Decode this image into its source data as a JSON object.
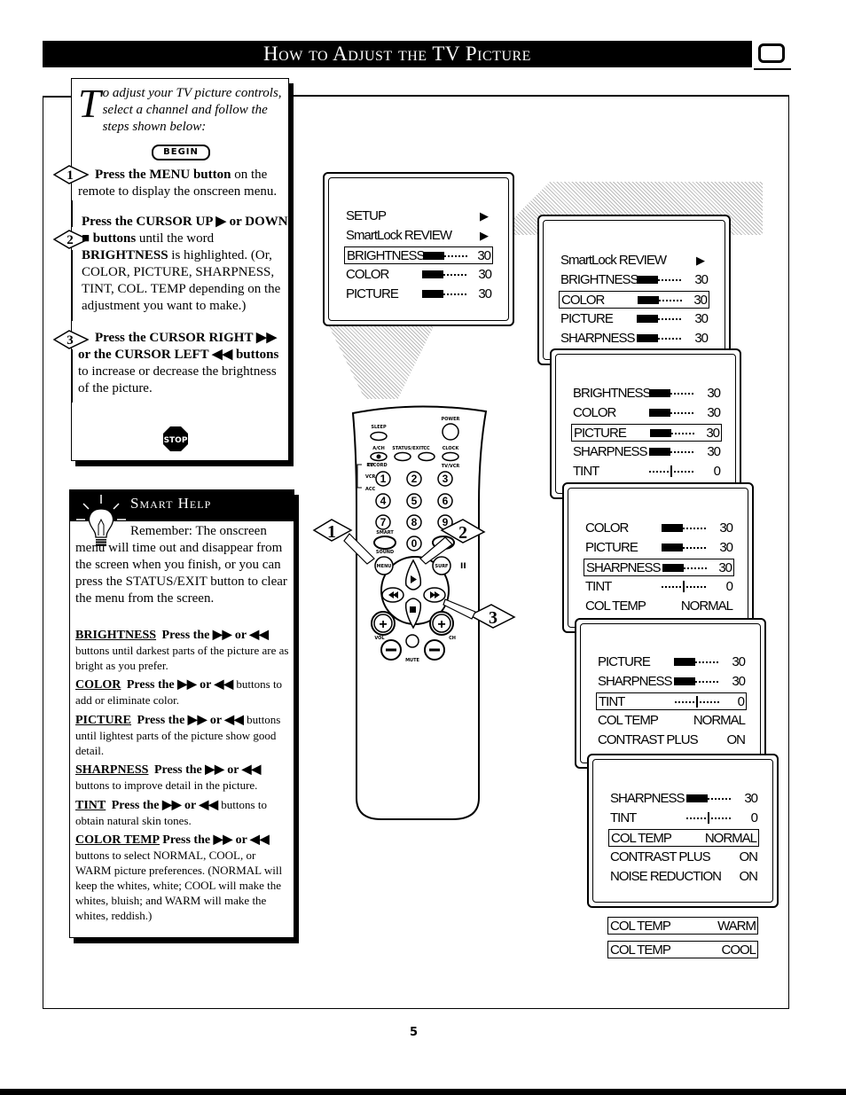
{
  "header": {
    "title": "How to Adjust the TV Picture",
    "icon": "tv-screen-icon"
  },
  "intro": {
    "drop_cap": "T",
    "text": "o adjust your TV picture controls, select a channel and follow the steps shown below:",
    "begin_label": "BEGIN"
  },
  "steps": [
    {
      "number": "1",
      "bold": "Press the MENU button",
      "text": " on the remote to display the onscreen menu."
    },
    {
      "number": "2",
      "bold": "Press the CURSOR UP ▶ or DOWN ■ buttons",
      "text": " until the word ",
      "bold2": "BRIGHTNESS",
      "text2": " is highlighted. (Or, COLOR, PICTURE, SHARPNESS, TINT, COL. TEMP depending on the adjustment you want to make.)"
    },
    {
      "number": "3",
      "bold": "Press the CURSOR RIGHT ▶▶ or the CURSOR LEFT ◀◀ buttons",
      "text": " to increase or decrease the brightness of the picture."
    }
  ],
  "stop_label": "STOP",
  "smart_help": {
    "title": "Smart Help",
    "intro": "Remember: The onscreen menu will time out and disappear from the screen when you finish, or you can press the STATUS/EXIT button to clear the menu from the screen.",
    "items": [
      {
        "keyword": "BRIGHTNESS",
        "lead": "Press the ▶▶ or ◀◀",
        "text": " buttons until darkest parts of the picture are as bright as you prefer."
      },
      {
        "keyword": "COLOR",
        "lead": "Press the ▶▶ or ◀◀",
        "text": " buttons to add or eliminate color."
      },
      {
        "keyword": "PICTURE",
        "lead": "Press the ▶▶ or ◀◀",
        "text": " buttons until lightest parts of the picture show good detail."
      },
      {
        "keyword": "SHARPNESS",
        "lead": "Press the ▶▶ or ◀◀",
        "text": " buttons to improve detail in the picture."
      },
      {
        "keyword": "TINT",
        "lead": "Press the ▶▶ or ◀◀",
        "text": " buttons to obtain natural skin tones."
      },
      {
        "keyword": "COLOR TEMP",
        "lead": "Press the ▶▶ or ◀◀",
        "text": " buttons to select NORMAL, COOL, or WARM picture preferences. (NORMAL will keep the whites, white; COOL will make the whites, bluish; and WARM will make the whites, reddish.)"
      }
    ]
  },
  "screens": [
    {
      "rows": [
        {
          "label": "SETUP",
          "type": "arrow"
        },
        {
          "label": "SmartLock REVIEW",
          "type": "arrow"
        },
        {
          "label": "BRIGHTNESS",
          "type": "bar",
          "value": "30",
          "level": 0.5,
          "highlight": true
        },
        {
          "label": "COLOR",
          "type": "bar",
          "value": "30",
          "level": 0.5
        },
        {
          "label": "PICTURE",
          "type": "bar",
          "value": "30",
          "level": 0.5
        }
      ]
    },
    {
      "rows": [
        {
          "label": "SmartLock REVIEW",
          "type": "arrow"
        },
        {
          "label": "BRIGHTNESS",
          "type": "bar",
          "value": "30",
          "level": 0.5
        },
        {
          "label": "COLOR",
          "type": "bar",
          "value": "30",
          "level": 0.5,
          "highlight": true
        },
        {
          "label": "PICTURE",
          "type": "bar",
          "value": "30",
          "level": 0.5
        },
        {
          "label": "SHARPNESS",
          "type": "bar",
          "value": "30",
          "level": 0.5
        }
      ]
    },
    {
      "rows": [
        {
          "label": "BRIGHTNESS",
          "type": "bar",
          "value": "30",
          "level": 0.5
        },
        {
          "label": "COLOR",
          "type": "bar",
          "value": "30",
          "level": 0.5
        },
        {
          "label": "PICTURE",
          "type": "bar",
          "value": "30",
          "level": 0.5,
          "highlight": true
        },
        {
          "label": "SHARPNESS",
          "type": "bar",
          "value": "30",
          "level": 0.5
        },
        {
          "label": "TINT",
          "type": "tint",
          "value": "0"
        }
      ]
    },
    {
      "rows": [
        {
          "label": "COLOR",
          "type": "bar",
          "value": "30",
          "level": 0.5
        },
        {
          "label": "PICTURE",
          "type": "bar",
          "value": "30",
          "level": 0.5
        },
        {
          "label": "SHARPNESS",
          "type": "bar",
          "value": "30",
          "level": 0.5,
          "highlight": true
        },
        {
          "label": "TINT",
          "type": "tint",
          "value": "0"
        },
        {
          "label": "COL TEMP",
          "type": "text",
          "value": "NORMAL"
        }
      ]
    },
    {
      "rows": [
        {
          "label": "PICTURE",
          "type": "bar",
          "value": "30",
          "level": 0.5
        },
        {
          "label": "SHARPNESS",
          "type": "bar",
          "value": "30",
          "level": 0.5
        },
        {
          "label": "TINT",
          "type": "tint",
          "value": "0",
          "highlight": true
        },
        {
          "label": "COL TEMP",
          "type": "text",
          "value": "NORMAL"
        },
        {
          "label": "CONTRAST PLUS",
          "type": "text",
          "value": "ON"
        }
      ]
    },
    {
      "rows": [
        {
          "label": "SHARPNESS",
          "type": "bar",
          "value": "30",
          "level": 0.5
        },
        {
          "label": "TINT",
          "type": "tint",
          "value": "0"
        },
        {
          "label": "COL TEMP",
          "type": "text",
          "value": "NORMAL",
          "highlight": true
        },
        {
          "label": "CONTRAST PLUS",
          "type": "text",
          "value": "ON"
        },
        {
          "label": "NOISE REDUCTION",
          "type": "text",
          "value": "ON"
        }
      ]
    }
  ],
  "col_temp_options": [
    {
      "label": "COL TEMP",
      "value": "WARM"
    },
    {
      "label": "COL TEMP",
      "value": "COOL"
    }
  ],
  "remote": {
    "labels": {
      "power": "POWER",
      "sleep": "SLEEP",
      "ach": "A/CH",
      "status": "STATUS/EXIT",
      "cc": "CC",
      "clock": "CLOCK",
      "record": "RECORD",
      "tvvcr": "TV/VCR",
      "tv": "TV",
      "vcr": "VCR",
      "acc": "ACC",
      "smart_pic": "SMART",
      "smart_sound": "SOUND",
      "menu": "MENU",
      "surf": "SURF",
      "vol": "VOL",
      "ch": "CH",
      "mute": "MUTE",
      "pause": "II"
    },
    "digits": [
      "1",
      "2",
      "3",
      "4",
      "5",
      "6",
      "7",
      "8",
      "9",
      "0"
    ],
    "callouts": [
      "1",
      "2",
      "3"
    ]
  },
  "page_number": "5"
}
